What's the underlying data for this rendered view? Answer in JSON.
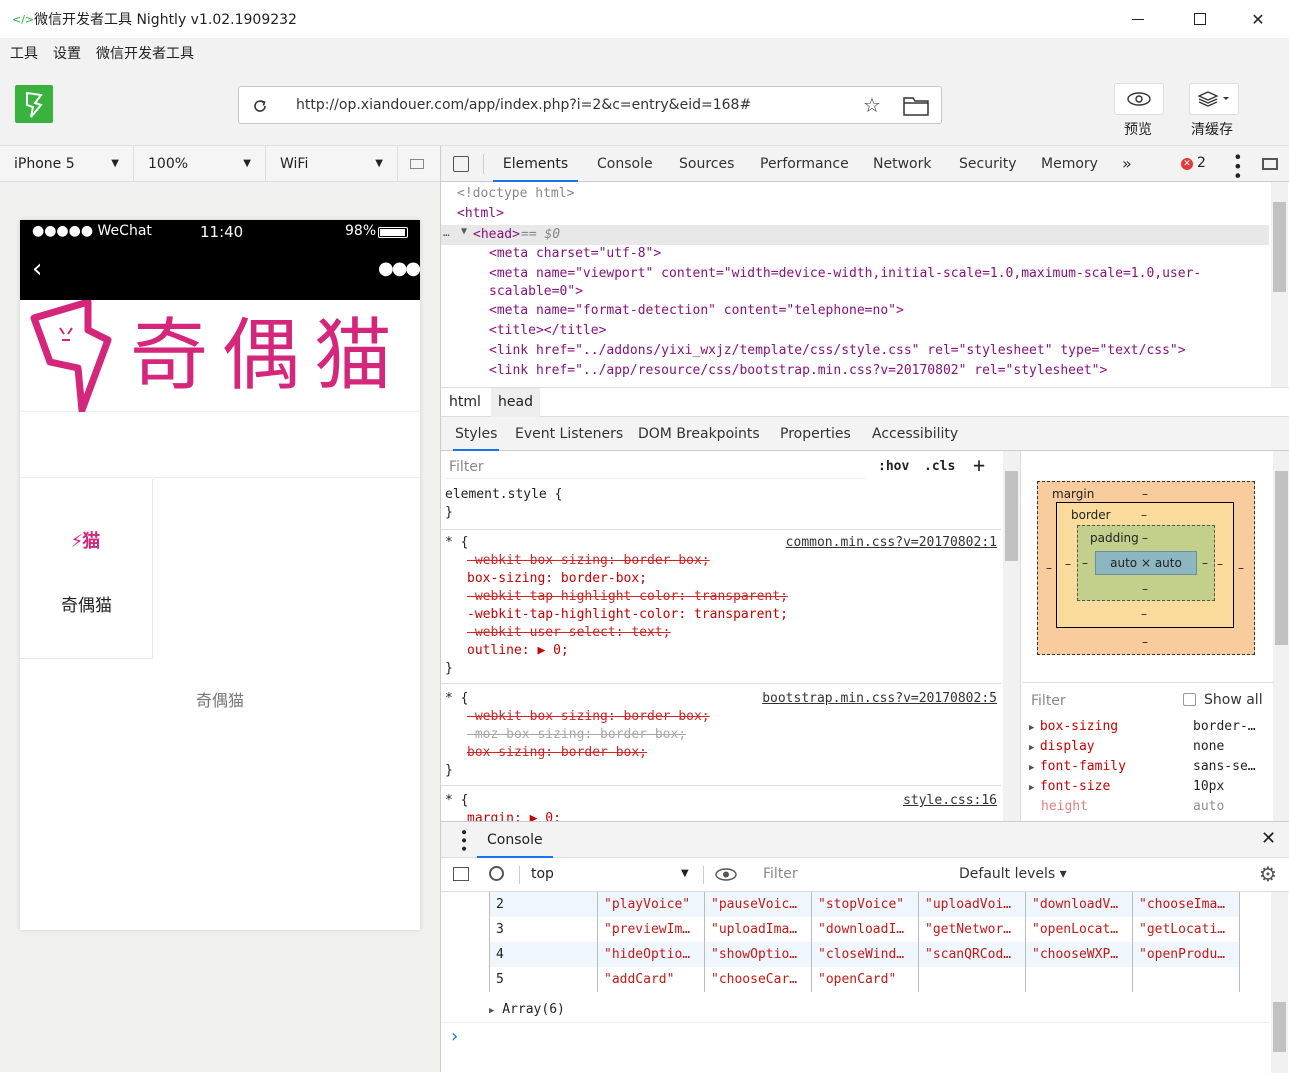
{
  "window": {
    "title": "微信开发者工具 Nightly v1.02.1909232",
    "logo": "</>"
  },
  "menu": [
    "工具",
    "设置",
    "微信开发者工具"
  ],
  "toolbar": {
    "url": "http://op.xiandouer.com/app/index.php?i=2&c=entry&eid=168#",
    "preview_label": "预览",
    "clear_cache_label": "清缓存"
  },
  "simulator": {
    "device": "iPhone 5",
    "zoom": "100%",
    "network": "WiFi",
    "status": {
      "signal": "●●●●● WeChat",
      "time": "11:40",
      "battery": "98%"
    },
    "tile_label": "奇偶猫",
    "footer_text": "奇偶猫",
    "banner_text": "奇偶猫"
  },
  "devtools": {
    "tabs": [
      "Elements",
      "Console",
      "Sources",
      "Performance",
      "Network",
      "Security",
      "Memory",
      "»"
    ],
    "error_count": "2",
    "breadcrumbs": [
      "html",
      "head"
    ],
    "subtabs": [
      "Styles",
      "Event Listeners",
      "DOM Breakpoints",
      "Properties",
      "Accessibility"
    ],
    "filter_placeholder": "Filter",
    "hov": ":hov",
    "cls": ".cls",
    "dom": {
      "doctype": "<!doctype html>",
      "html": "<html>",
      "head": "<head>",
      "head_suffix": " == $0",
      "meta1": "<meta charset=\"utf-8\">",
      "meta2a": "<meta name=\"viewport\" content=\"width=device-width,initial-scale=1.0,maximum-scale=1.0,user-",
      "meta2b": "scalable=0\">",
      "meta3": "<meta name=\"format-detection\" content=\"telephone=no\">",
      "title": "<title></title>",
      "link1": "<link href=\"../addons/yixi_wxjz/template/css/style.css\" rel=\"stylesheet\" type=\"text/css\">",
      "link2": "<link href=\"../app/resource/css/bootstrap.min.css?v=20170802\" rel=\"stylesheet\">"
    },
    "styles": {
      "element_style": "element.style {",
      "close": "}",
      "rule1_selector": "* {",
      "rule1_source": "common.min.css?v=20170802:1",
      "rule1_props": [
        "-webkit-box-sizing: border-box;",
        "box-sizing: border-box;",
        "-webkit-tap-highlight-color: transparent;",
        "-webkit-tap-highlight-color: transparent;",
        "-webkit-user-select: text;",
        "outline: ▶ 0;"
      ],
      "rule2_selector": "* {",
      "rule2_source": "bootstrap.min.css?v=20170802:5",
      "rule2_props": [
        "-webkit-box-sizing: border-box;",
        "-moz-box-sizing: border-box;",
        "box-sizing: border-box;"
      ],
      "rule3_selector": "* {",
      "rule3_source": "style.css:16",
      "rule3_props": [
        "margin: ▶ 0;"
      ]
    },
    "boxmodel": {
      "margin": "margin",
      "border": "border",
      "padding": "padding",
      "content": "auto × auto",
      "dash": "–"
    },
    "computed": {
      "filter": "Filter",
      "show_all": "Show all",
      "rows": [
        {
          "name": "box-sizing",
          "value": "border-…"
        },
        {
          "name": "display",
          "value": "none"
        },
        {
          "name": "font-family",
          "value": "sans-se…"
        },
        {
          "name": "font-size",
          "value": "10px"
        },
        {
          "name": "height",
          "value": "auto"
        }
      ]
    },
    "console": {
      "title": "Console",
      "context": "top",
      "filter": "Filter",
      "levels": "Default levels ▾",
      "rows": [
        [
          "2",
          "\"playVoice\"",
          "\"pauseVoic…",
          "\"stopVoice\"",
          "\"uploadVoi…",
          "\"downloadV…",
          "\"chooseIma…"
        ],
        [
          "3",
          "\"previewIm…",
          "\"uploadIma…",
          "\"downloadI…",
          "\"getNetwor…",
          "\"openLocat…",
          "\"getLocati…"
        ],
        [
          "4",
          "\"hideOptio…",
          "\"showOptio…",
          "\"closeWind…",
          "\"scanQRCod…",
          "\"chooseWXP…",
          "\"openProdu…"
        ],
        [
          "5",
          "\"addCard\"",
          "\"chooseCar…",
          "\"openCard\"",
          "",
          "",
          ""
        ]
      ],
      "array_label": "Array(6)",
      "prompt": "›"
    }
  }
}
